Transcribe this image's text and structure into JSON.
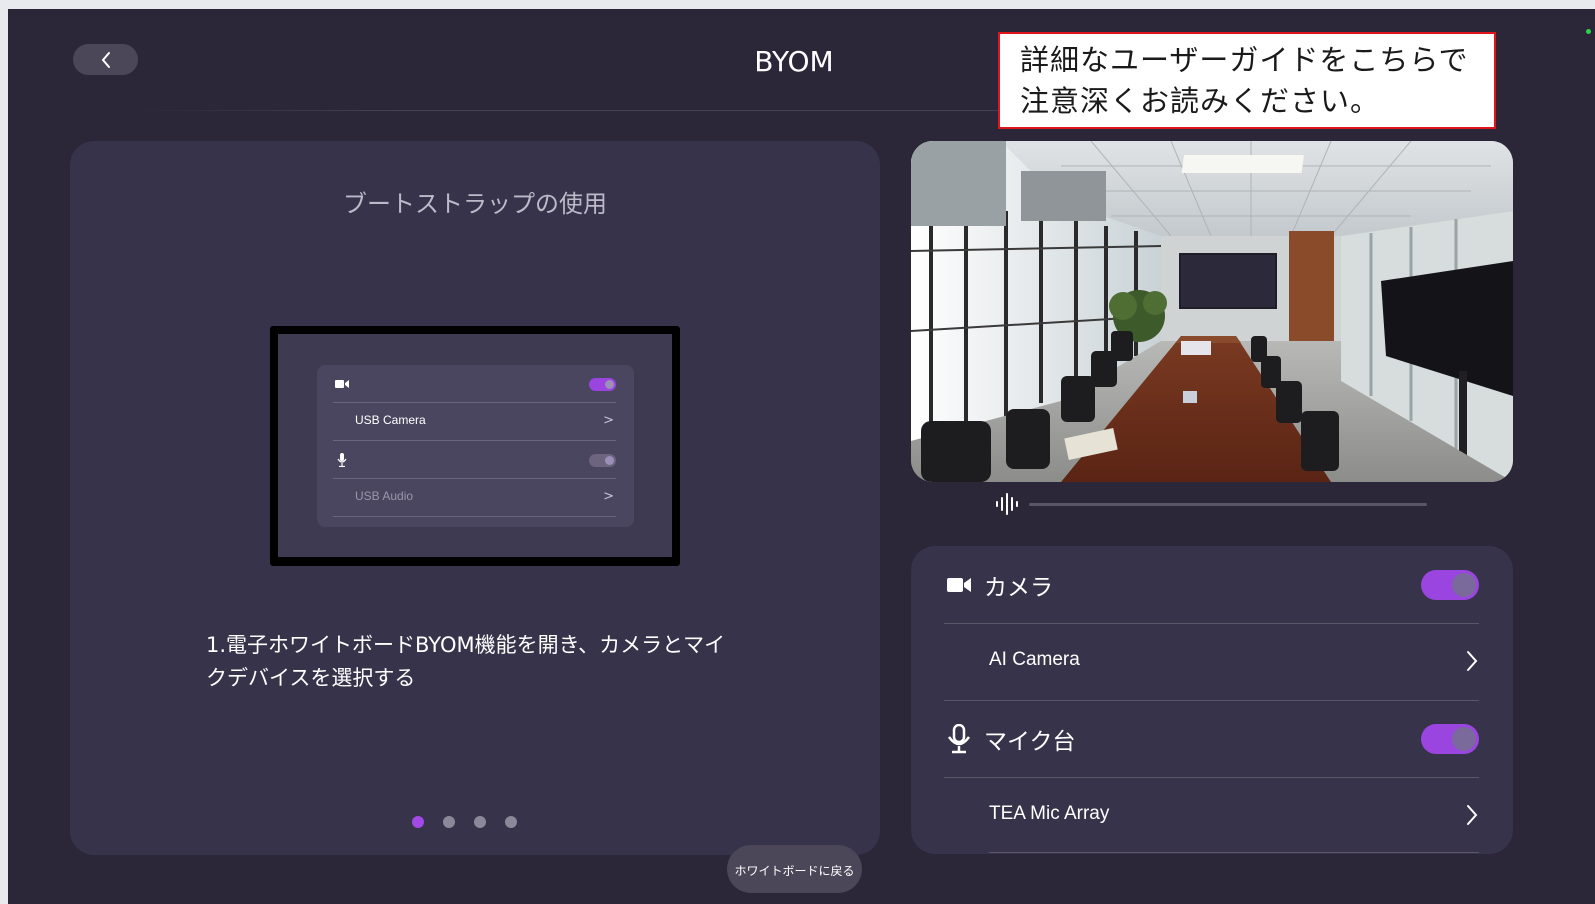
{
  "header": {
    "title": "BYOM",
    "back_icon": "chevron-left-icon"
  },
  "annotation": {
    "line1": "詳細なユーザーガイドをこちらで",
    "line2": "注意深くお読みください。"
  },
  "guide": {
    "title": "ブートストラップの使用",
    "preview": {
      "camera_label": "USB Camera",
      "audio_label": "USB Audio",
      "camera_on": true,
      "audio_on": false
    },
    "step_line1": "1.電子ホワイトボードBYOM機能を開き、カメラとマイ",
    "step_line2": "クデバイスを選択する",
    "page_count": 4,
    "active_page": 1
  },
  "devices": {
    "camera": {
      "label": "カメラ",
      "icon": "video-camera-icon",
      "enabled": true,
      "device": "AI Camera"
    },
    "mic": {
      "label": "マイク台",
      "icon": "microphone-icon",
      "enabled": true,
      "device": "TEA Mic Array"
    }
  },
  "audio_level": {
    "icon": "audio-wave-icon",
    "level": 0
  },
  "footer": {
    "return_label": "ホワイトボードに戻る"
  },
  "colors": {
    "accent": "#9a45e0",
    "background": "#2b2739",
    "card": "#37334a"
  }
}
